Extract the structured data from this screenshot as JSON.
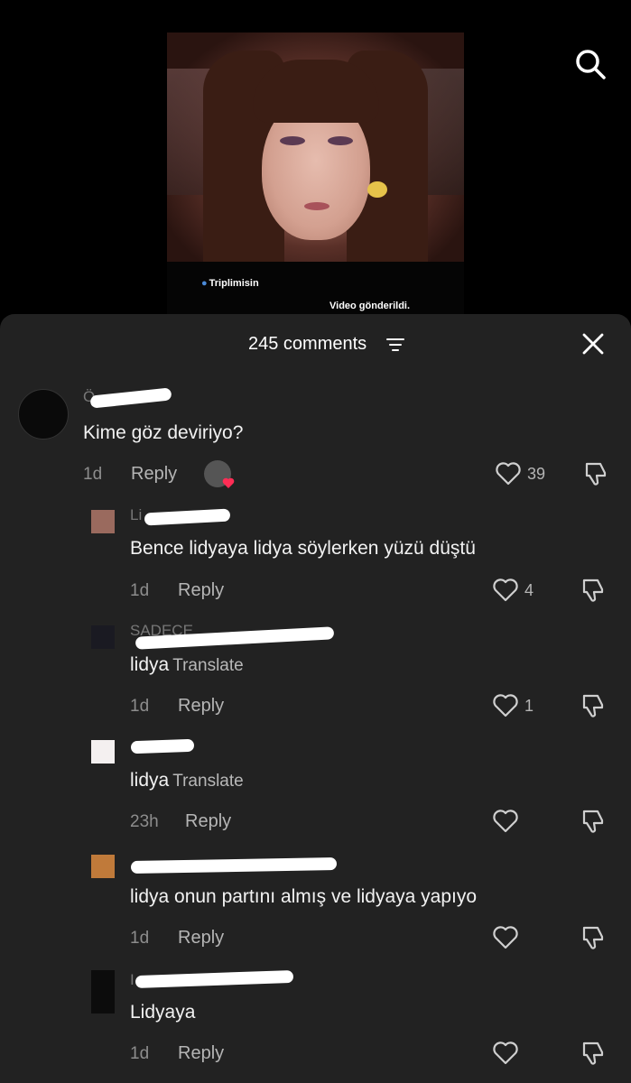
{
  "video": {
    "caption_user": "Triplimisin",
    "caption_status": "Video gönderildi."
  },
  "sheet": {
    "comments_title": "245 comments"
  },
  "comments": [
    {
      "text": "Kime göz deviriyo?",
      "time": "1d",
      "reply_label": "Reply",
      "likes": "39",
      "author_visible": "Ö"
    },
    {
      "text": "Bence lidyaya lidya söylerken yüzü düştü",
      "time": "1d",
      "reply_label": "Reply",
      "likes": "4",
      "author_visible": "Li"
    },
    {
      "text": "lidya",
      "translate": "Translate",
      "time": "1d",
      "reply_label": "Reply",
      "likes": "1",
      "author_visible": "SADECE"
    },
    {
      "text": "lidya",
      "translate": "Translate",
      "time": "23h",
      "reply_label": "Reply",
      "likes": ""
    },
    {
      "text": "lidya onun partını almış ve lidyaya yapıyo",
      "time": "1d",
      "reply_label": "Reply",
      "likes": ""
    },
    {
      "text": "Lidyaya",
      "time": "1d",
      "reply_label": "Reply",
      "likes": "",
      "author_visible": "I"
    }
  ],
  "colors": {
    "sheet_bg": "#222222",
    "like_heart": "#ff2d55",
    "link_blue": "#4a8ad8"
  }
}
